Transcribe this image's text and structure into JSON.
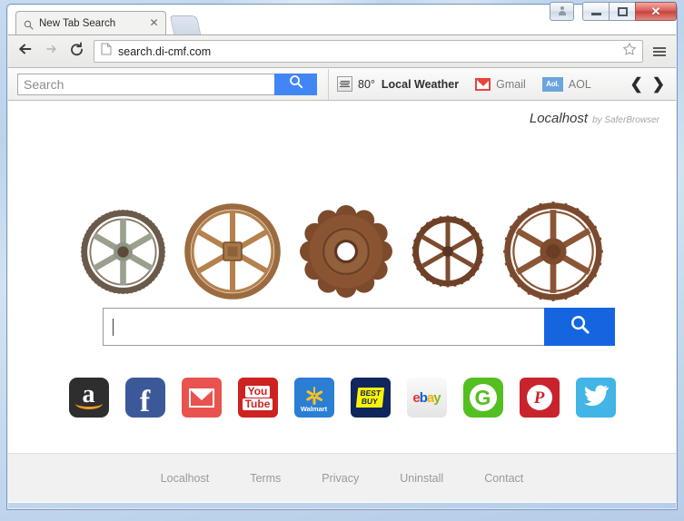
{
  "window": {
    "caption_buttons": [
      {
        "name": "user-account-button",
        "label": ""
      },
      {
        "name": "minimize-button",
        "label": ""
      },
      {
        "name": "maximize-button",
        "label": ""
      },
      {
        "name": "close-button",
        "label": "✕"
      }
    ]
  },
  "browser": {
    "tab": {
      "title": "New Tab Search",
      "close_label": "✕",
      "favicon": "search-icon"
    },
    "new_tab_button": "new-tab-button",
    "nav": {
      "back": "back-arrow-icon",
      "forward": "forward-arrow-icon",
      "reload": "reload-icon",
      "url": "search.di-cmf.com",
      "page_icon": "page-document-icon",
      "bookmark": "star-icon",
      "menu": "hamburger-menu-icon"
    }
  },
  "ext_toolbar": {
    "search_placeholder": "Search",
    "search_value": "",
    "search_button": "search-icon",
    "items": [
      {
        "icon": "weather-icon",
        "temp": "80°",
        "label": "Local Weather",
        "bold": true
      },
      {
        "icon": "gmail-icon",
        "label": "Gmail",
        "bold": false
      },
      {
        "icon": "aol-icon",
        "icon_text": "Aol.",
        "label": "AOL",
        "bold": false
      }
    ],
    "prev_arrow": "❮",
    "next_arrow": "❯"
  },
  "page": {
    "brand": {
      "name": "Localhost",
      "by": "by SaferBrowser"
    },
    "gears": [
      {
        "name": "gear-spoked-pale-green",
        "teeth": 60,
        "spokes": 6,
        "outer": "#6b5a4a",
        "body": "#9aa08e",
        "hub": "#5d4a3a",
        "size": 95
      },
      {
        "name": "gear-spoked-tan",
        "teeth": 64,
        "spokes": 6,
        "outer": "#9b6b3f",
        "body": "#b5824d",
        "hub": "#7a5530",
        "size": 110
      },
      {
        "name": "gear-solid-rusty",
        "teeth": 12,
        "spokes": 0,
        "outer": "#7d4a2c",
        "body": "#8a5332",
        "hub": "#5e3620",
        "size": 104
      },
      {
        "name": "gear-spoked-dark-rust",
        "teeth": 30,
        "spokes": 6,
        "outer": "#6e4026",
        "body": "#7d4c2e",
        "hub": "#5a3320",
        "size": 84
      },
      {
        "name": "gear-wheel-rusty-large",
        "teeth": 24,
        "spokes": 6,
        "outer": "#7b4a2e",
        "body": "#8b5636",
        "hub": "#6a3d24",
        "size": 112
      }
    ],
    "search": {
      "value": "",
      "placeholder": "",
      "button_icon": "search-icon",
      "button_color": "#1565e0"
    },
    "shortcuts": [
      {
        "name": "shortcut-amazon",
        "label": "amazon",
        "class": "sc-amazon"
      },
      {
        "name": "shortcut-facebook",
        "label": "facebook",
        "class": "sc-facebook"
      },
      {
        "name": "shortcut-gmail",
        "label": "gmail",
        "class": "sc-gmail"
      },
      {
        "name": "shortcut-youtube",
        "label": "youtube",
        "class": "sc-youtube"
      },
      {
        "name": "shortcut-walmart",
        "label": "walmart",
        "class": "sc-walmart"
      },
      {
        "name": "shortcut-bestbuy",
        "label": "bestbuy",
        "class": "sc-bestbuy"
      },
      {
        "name": "shortcut-ebay",
        "label": "ebay",
        "class": "sc-ebay"
      },
      {
        "name": "shortcut-groupon",
        "label": "groupon",
        "class": "sc-groupon"
      },
      {
        "name": "shortcut-pinterest",
        "label": "pinterest",
        "class": "sc-pinterest"
      },
      {
        "name": "shortcut-twitter",
        "label": "twitter",
        "class": "sc-twitter"
      }
    ],
    "shortcut_text": {
      "amazon_letter": "a",
      "facebook_letter": "f",
      "youtube_you": "You",
      "youtube_tube": "Tube",
      "walmart_label": "Walmart",
      "bestbuy_line1": "BEST",
      "bestbuy_line2": "BUY",
      "ebay_e": "e",
      "ebay_b": "b",
      "ebay_a": "a",
      "ebay_y": "y",
      "groupon_letter": "G",
      "pinterest_letter": "P"
    },
    "footer_links": [
      {
        "name": "footer-link-localhost",
        "label": "Localhost"
      },
      {
        "name": "footer-link-terms",
        "label": "Terms"
      },
      {
        "name": "footer-link-privacy",
        "label": "Privacy"
      },
      {
        "name": "footer-link-uninstall",
        "label": "Uninstall"
      },
      {
        "name": "footer-link-contact",
        "label": "Contact"
      }
    ]
  },
  "colors": {
    "accent_blue": "#1565e0",
    "toolbar_blue": "#4286f5",
    "footer_bg": "#f1f1f1"
  }
}
